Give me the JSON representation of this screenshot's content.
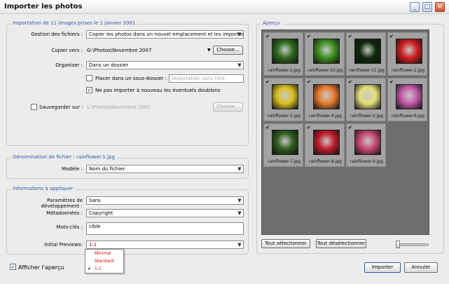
{
  "window": {
    "title": "Importer les photos"
  },
  "import_group": {
    "title": "Importation de 11 images prises le 1 janvier 2001",
    "file_handling_label": "Gestion des fichiers :",
    "file_handling_value": "Copier les photos dans un nouvel emplacement et les importer",
    "copy_to_label": "Copier vers :",
    "copy_to_value": "G:\\Photos\\Novembre 2007",
    "choose_label": "Choose...",
    "organize_label": "Organiser :",
    "organize_value": "Dans un dossier",
    "subfolder_label": "Placer dans un sous-dossier :",
    "subfolder_placeholder": "Importation sans titre",
    "no_duplicates_label": "Ne pas importer à nouveau les éventuels doublons",
    "backup_label": "Sauvegarder sur :",
    "backup_value": "L:\\Photos\\Novembre 2007",
    "backup_choose_label": "Choose..."
  },
  "naming_group": {
    "title": "Dénomination de fichier : rainflower-1.jpg",
    "model_label": "Modèle :",
    "model_value": "Nom du fichier"
  },
  "info_group": {
    "title": "Informations à appliquer",
    "dev_settings_label": "Paramètres de développement :",
    "dev_settings_value": "Sans",
    "metadata_label": "Métadonnées :",
    "metadata_value": "Copyright",
    "keywords_label": "Mots-clés :",
    "keywords_value": "cible",
    "previews_label": "Initial Previews:",
    "previews_value": "1:1",
    "previews_options": [
      "Minimal",
      "Standard",
      "1:1"
    ]
  },
  "preview_group": {
    "title": "Aperçu",
    "select_all": "Tout sélectionner",
    "deselect_all": "Tout désélectionner",
    "thumbnails": [
      {
        "caption": "rainflower-1.jpg",
        "color": "#2d6a1a"
      },
      {
        "caption": "rainflower-10.jpg",
        "color": "#3d8f20"
      },
      {
        "caption": "rainflower-11.jpg",
        "color": "#0f2a0a"
      },
      {
        "caption": "rainflower-2.jpg",
        "color": "#d01f1f"
      },
      {
        "caption": "rainflower-3.jpg",
        "color": "#d9c021"
      },
      {
        "caption": "rainflower-4.jpg",
        "color": "#e87a2e"
      },
      {
        "caption": "rainflower-5.jpg",
        "color": "#e6e07a"
      },
      {
        "caption": "rainflower-6.jpg",
        "color": "#c45aa8"
      },
      {
        "caption": "rainflower-7.jpg",
        "color": "#2f5d1f"
      },
      {
        "caption": "rainflower-8.jpg",
        "color": "#c21d2c"
      },
      {
        "caption": "rainflower-9.jpg",
        "color": "#c94872"
      }
    ]
  },
  "footer": {
    "show_preview_label": "Afficher l'aperçu",
    "import_button": "Importer",
    "cancel_button": "Annuler"
  }
}
